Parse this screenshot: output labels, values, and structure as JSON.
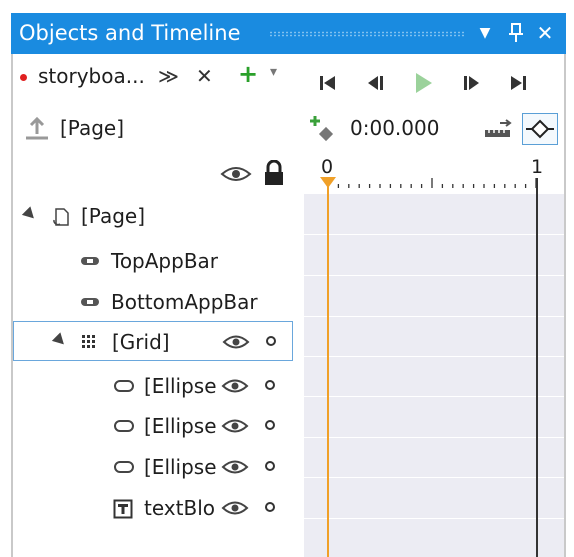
{
  "title_bar": {
    "title": "Objects and Timeline",
    "menu_glyph": "▼",
    "pin_glyph": "⊥",
    "close_glyph": "✕"
  },
  "storyboard": {
    "name": "storyboa...",
    "collapse_glyph": "≫",
    "close_glyph": "✕",
    "add_glyph": "+",
    "dropdown_glyph": "▾"
  },
  "scope_root": "[Page]",
  "tree": {
    "page": "[Page]",
    "top_app_bar": "TopAppBar",
    "bottom_app_bar": "BottomAppBar",
    "grid": "[Grid]",
    "ellipse_1": "[Ellipse",
    "ellipse_2": "[Ellipse",
    "ellipse_3": "[Ellipse",
    "text_block": "textBlo"
  },
  "timeline": {
    "current_time": "0:00.000",
    "ruler_start": "0",
    "ruler_end": "1"
  },
  "colors": {
    "accent": "#1a8be0",
    "playhead": "#f0a028",
    "recording_dot": "#e02020",
    "add_green": "#2aa02a",
    "track_bg": "#ececf3"
  }
}
